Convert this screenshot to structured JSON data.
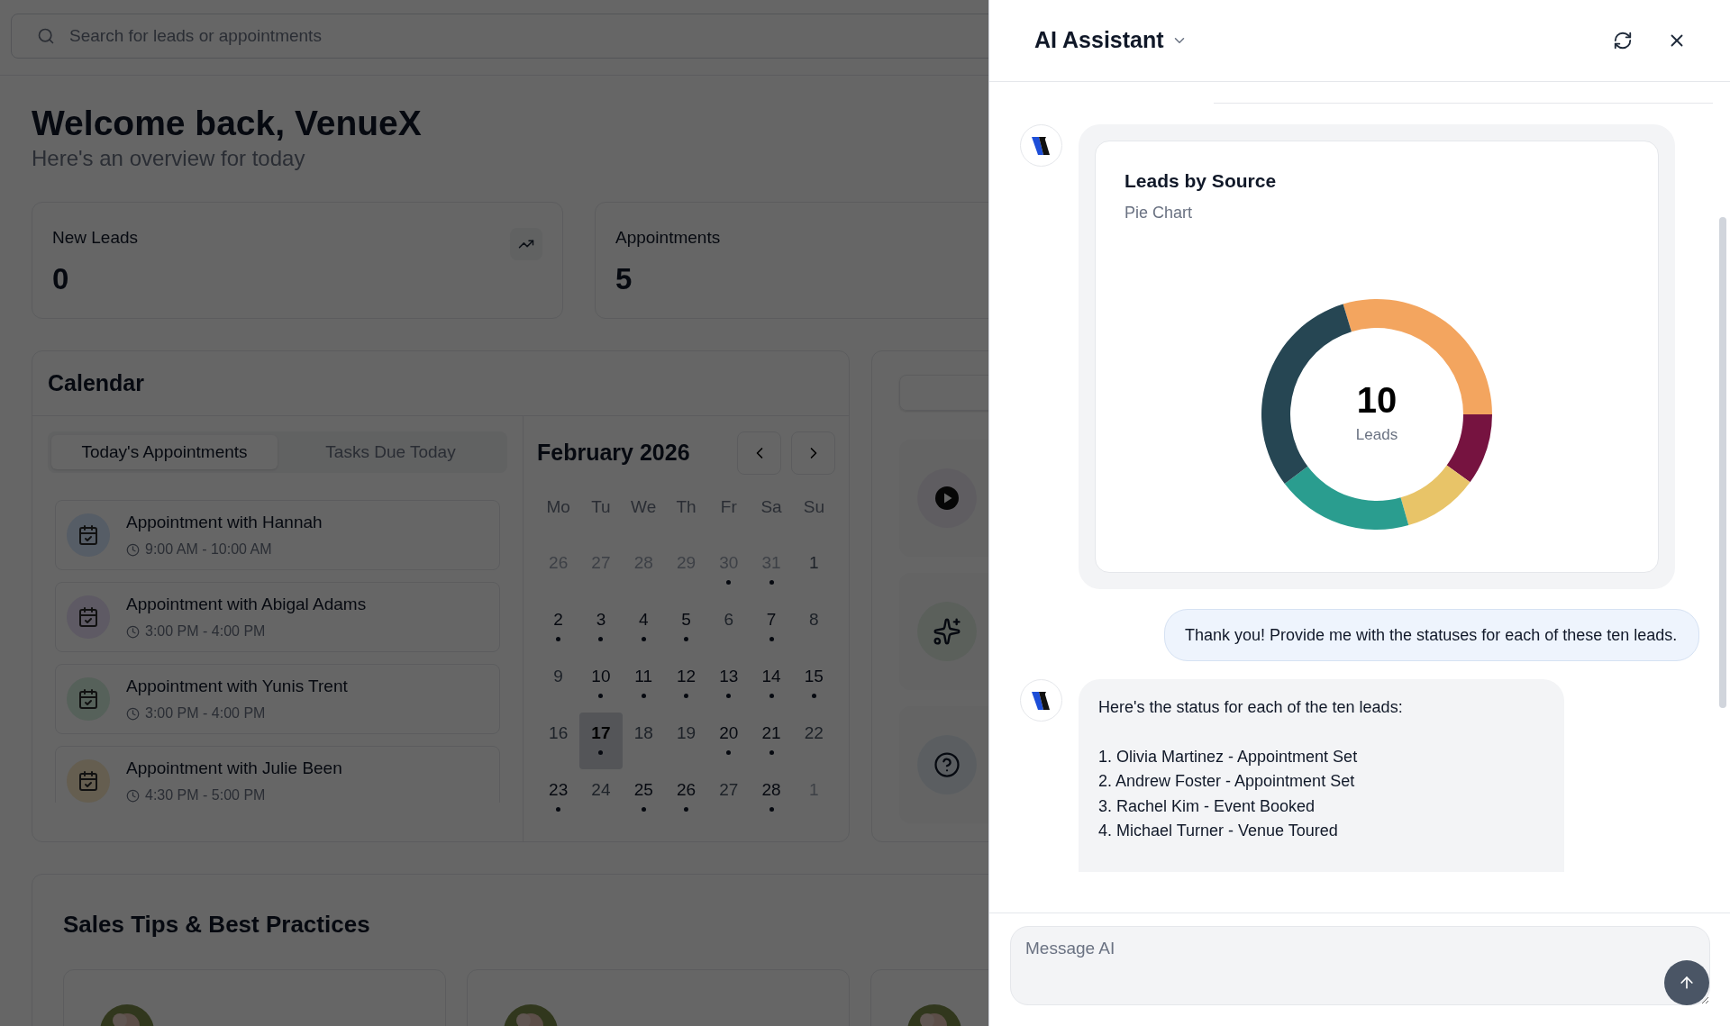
{
  "search": {
    "placeholder": "Search for leads or appointments"
  },
  "welcome": {
    "title": "Welcome back, VenueX",
    "subtitle": "Here's an overview for today"
  },
  "stats": [
    {
      "label": "New Leads",
      "value": "0",
      "trend_icon": true
    },
    {
      "label": "Appointments",
      "value": "5"
    }
  ],
  "calendar": {
    "title": "Calendar",
    "tabs": [
      {
        "label": "Today's Appointments",
        "selected": true
      },
      {
        "label": "Tasks Due Today",
        "selected": false
      }
    ],
    "appointments": [
      {
        "title": "Appointment with Hannah",
        "time": "9:00 AM - 10:00 AM",
        "color": "#565d66"
      },
      {
        "title": "Appointment with Abigal Adams",
        "time": "3:00 PM - 4:00 PM",
        "color": "#5e5a64"
      },
      {
        "title": "Appointment with Yunis Trent",
        "time": "3:00 PM - 4:00 PM",
        "color": "#56615a"
      },
      {
        "title": "Appointment with Julie Been",
        "time": "4:30 PM - 5:00 PM",
        "color": "#655e50"
      }
    ],
    "month": "February 2026",
    "weekdays": [
      "Mo",
      "Tu",
      "We",
      "Th",
      "Fr",
      "Sa",
      "Su"
    ],
    "weeks": [
      [
        {
          "day": "26",
          "muted": true,
          "dot": false,
          "selected": false
        },
        {
          "day": "27",
          "muted": true,
          "dot": false,
          "selected": false
        },
        {
          "day": "28",
          "muted": true,
          "dot": false,
          "selected": false
        },
        {
          "day": "29",
          "muted": true,
          "dot": false,
          "selected": false
        },
        {
          "day": "30",
          "muted": true,
          "dot": true,
          "selected": false
        },
        {
          "day": "31",
          "muted": true,
          "dot": true,
          "selected": false
        },
        {
          "day": "1",
          "muted": false,
          "dot": false,
          "selected": false
        }
      ],
      [
        {
          "day": "2",
          "muted": false,
          "dot": true,
          "selected": false
        },
        {
          "day": "3",
          "muted": false,
          "dot": true,
          "selected": false
        },
        {
          "day": "4",
          "muted": false,
          "dot": true,
          "selected": false
        },
        {
          "day": "5",
          "muted": false,
          "dot": true,
          "selected": false
        },
        {
          "day": "6",
          "muted": false,
          "dot": false,
          "selected": false
        },
        {
          "day": "7",
          "muted": false,
          "dot": true,
          "selected": false
        },
        {
          "day": "8",
          "muted": false,
          "dot": false,
          "selected": false
        }
      ],
      [
        {
          "day": "9",
          "muted": false,
          "dot": false,
          "selected": false
        },
        {
          "day": "10",
          "muted": false,
          "dot": true,
          "selected": false
        },
        {
          "day": "11",
          "muted": false,
          "dot": true,
          "selected": false
        },
        {
          "day": "12",
          "muted": false,
          "dot": true,
          "selected": false
        },
        {
          "day": "13",
          "muted": false,
          "dot": true,
          "selected": false
        },
        {
          "day": "14",
          "muted": false,
          "dot": true,
          "selected": false
        },
        {
          "day": "15",
          "muted": false,
          "dot": true,
          "selected": false
        }
      ],
      [
        {
          "day": "16",
          "muted": false,
          "dot": false,
          "selected": false
        },
        {
          "day": "17",
          "muted": false,
          "dot": true,
          "selected": true
        },
        {
          "day": "18",
          "muted": false,
          "dot": false,
          "selected": false
        },
        {
          "day": "19",
          "muted": false,
          "dot": false,
          "selected": false
        },
        {
          "day": "20",
          "muted": false,
          "dot": true,
          "selected": false
        },
        {
          "day": "21",
          "muted": false,
          "dot": true,
          "selected": false
        },
        {
          "day": "22",
          "muted": false,
          "dot": false,
          "selected": false
        }
      ],
      [
        {
          "day": "23",
          "muted": false,
          "dot": true,
          "selected": false
        },
        {
          "day": "24",
          "muted": false,
          "dot": false,
          "selected": false
        },
        {
          "day": "25",
          "muted": false,
          "dot": true,
          "selected": false
        },
        {
          "day": "26",
          "muted": false,
          "dot": true,
          "selected": false
        },
        {
          "day": "27",
          "muted": false,
          "dot": false,
          "selected": false
        },
        {
          "day": "28",
          "muted": false,
          "dot": true,
          "selected": false
        },
        {
          "day": "1",
          "muted": true,
          "dot": false,
          "selected": false
        }
      ]
    ]
  },
  "side_actions": [
    {
      "kind": "play"
    },
    {
      "kind": "sparkle"
    },
    {
      "kind": "help"
    }
  ],
  "sales_tips": {
    "title": "Sales Tips & Best Practices"
  },
  "assistant": {
    "title": "AI Assistant",
    "messages": [
      {
        "kind": "chart",
        "title": "Leads by Source",
        "subtitle": "Pie Chart",
        "total": "10",
        "total_label": "Leads"
      },
      {
        "kind": "user",
        "text": "Thank you! Provide me with the statuses for each of these ten leads."
      },
      {
        "kind": "reply",
        "text": "Here's the status for each of the ten leads:",
        "items": [
          "1. Olivia Martinez - Appointment Set",
          "2. Andrew Foster - Appointment Set",
          "3. Rachel Kim - Event Booked",
          "4. Michael Turner - Venue Toured"
        ]
      }
    ],
    "input": {
      "placeholder": "Message AI"
    }
  }
}
